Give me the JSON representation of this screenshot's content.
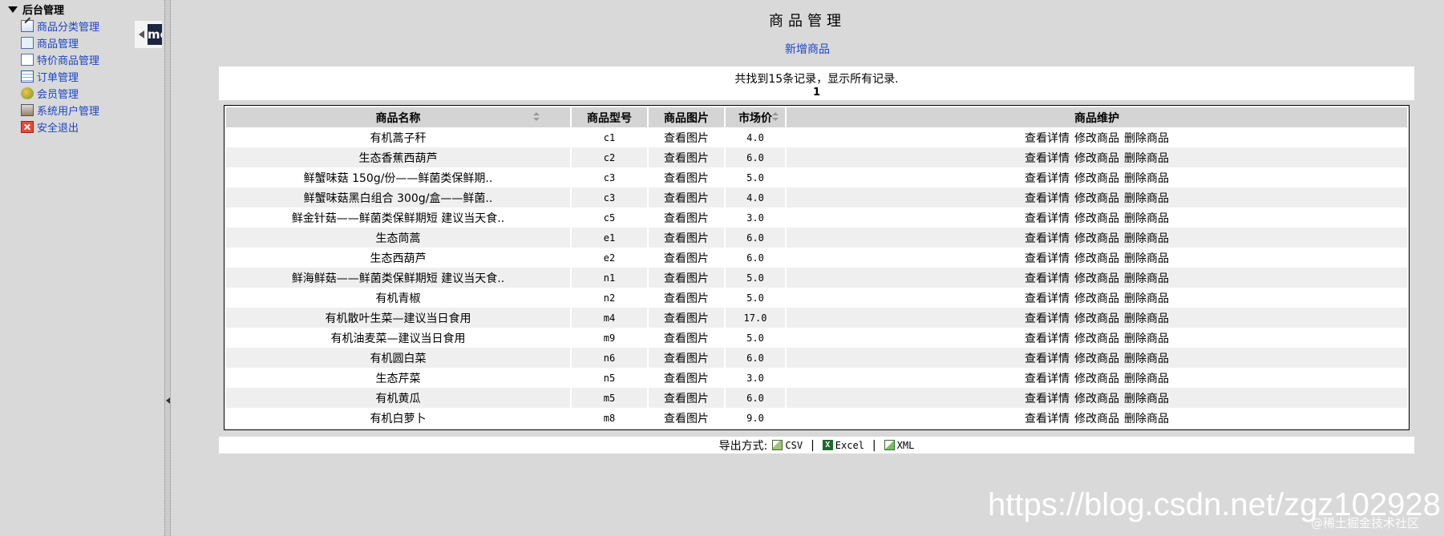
{
  "sidebar": {
    "root_label": "后台管理",
    "items": [
      {
        "label": "商品分类管理",
        "icon": "category-edit-icon"
      },
      {
        "label": "商品管理",
        "icon": "product-icon"
      },
      {
        "label": "特价商品管理",
        "icon": "special-product-icon"
      },
      {
        "label": "订单管理",
        "icon": "order-list-icon"
      },
      {
        "label": "会员管理",
        "icon": "members-icon"
      },
      {
        "label": "系统用户管理",
        "icon": "system-user-icon"
      },
      {
        "label": "安全退出",
        "icon": "exit-icon"
      }
    ]
  },
  "collapse_tab_logo": "me",
  "main": {
    "title": "商品管理",
    "add_link": "新增商品",
    "summary": "共找到15条记录，显示所有记录.",
    "page": "1"
  },
  "table": {
    "columns": [
      "商品名称",
      "商品型号",
      "商品图片",
      "市场价",
      "商品维护"
    ],
    "view_pic_label": "查看图片",
    "actions": [
      "查看详情",
      "修改商品",
      "删除商品"
    ],
    "rows": [
      {
        "name": "有机蒿子秆",
        "model": "c1",
        "price": "4.0"
      },
      {
        "name": "生态香蕉西葫芦",
        "model": "c2",
        "price": "6.0"
      },
      {
        "name": "鲜蟹味菇 150g/份——鲜菌类保鲜期..",
        "model": "c3",
        "price": "5.0"
      },
      {
        "name": "鲜蟹味菇黑白组合 300g/盒——鲜菌..",
        "model": "c3",
        "price": "4.0"
      },
      {
        "name": "鲜金针菇——鲜菌类保鲜期短 建议当天食..",
        "model": "c5",
        "price": "3.0"
      },
      {
        "name": "生态茼蒿",
        "model": "e1",
        "price": "6.0"
      },
      {
        "name": "生态西葫芦",
        "model": "e2",
        "price": "6.0"
      },
      {
        "name": "鲜海鲜菇——鲜菌类保鲜期短 建议当天食..",
        "model": "n1",
        "price": "5.0"
      },
      {
        "name": "有机青椒",
        "model": "n2",
        "price": "5.0"
      },
      {
        "name": "有机散叶生菜—建议当日食用",
        "model": "m4",
        "price": "17.0"
      },
      {
        "name": "有机油麦菜—建议当日食用",
        "model": "m9",
        "price": "5.0"
      },
      {
        "name": "有机圆白菜",
        "model": "n6",
        "price": "6.0"
      },
      {
        "name": "生态芹菜",
        "model": "n5",
        "price": "3.0"
      },
      {
        "name": "有机黄瓜",
        "model": "m5",
        "price": "6.0"
      },
      {
        "name": "有机白萝卜",
        "model": "m8",
        "price": "9.0"
      }
    ]
  },
  "export": {
    "label": "导出方式:",
    "options": [
      "CSV",
      "Excel",
      "XML"
    ]
  },
  "watermark": {
    "url": "https://blog.csdn.net/zgz102928",
    "community": "@稀土掘金技术社区"
  }
}
